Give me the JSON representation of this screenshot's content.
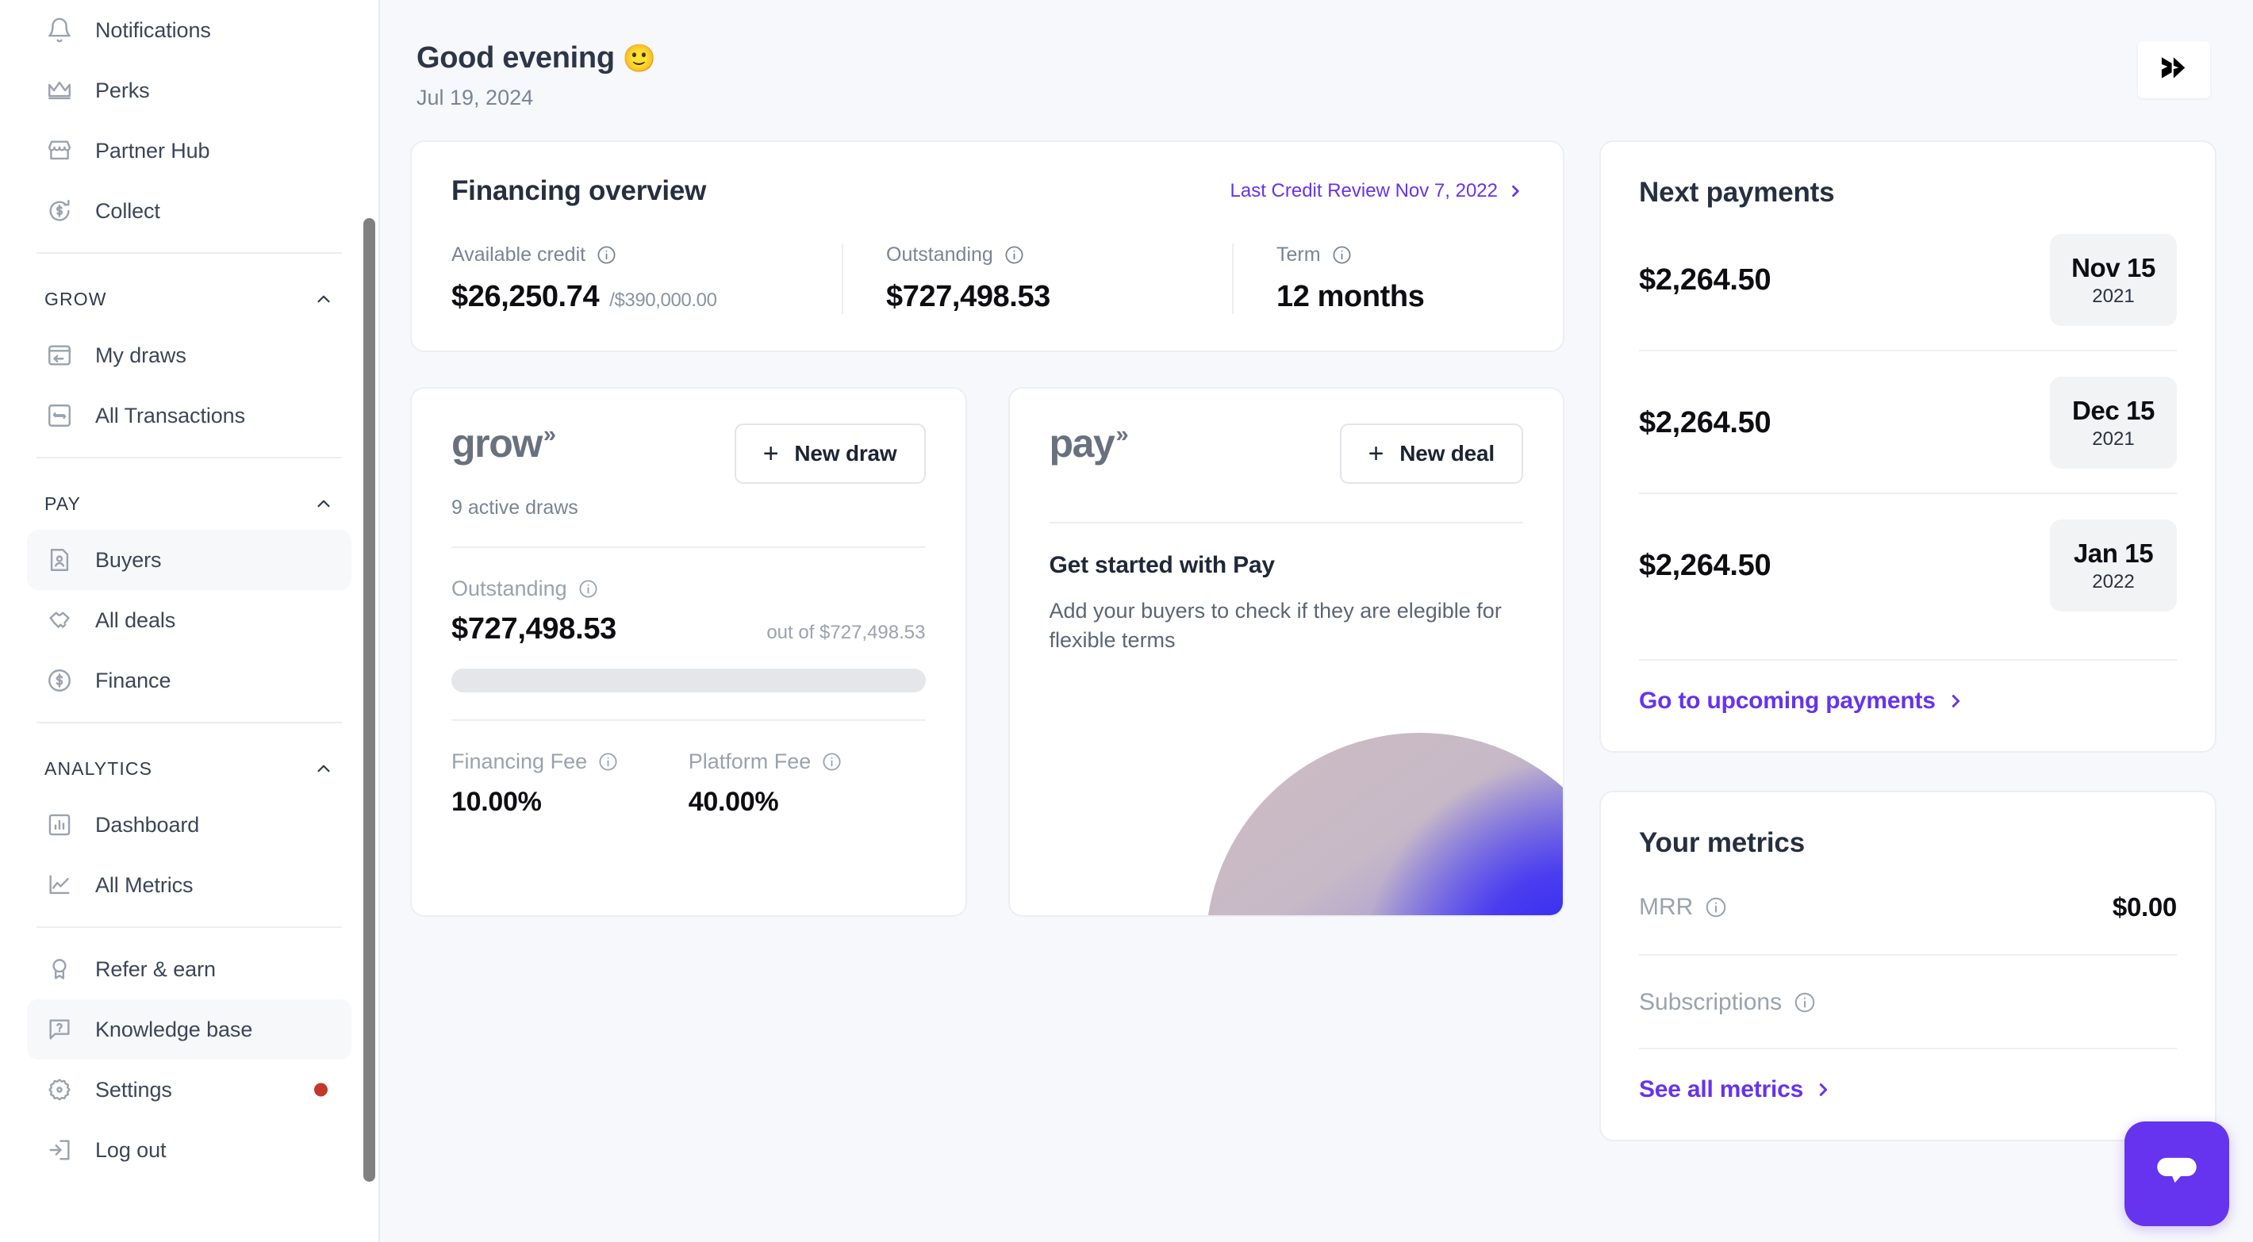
{
  "sidebar": {
    "top_items": [
      {
        "label": "Notifications",
        "icon": "bell-icon",
        "active": false
      },
      {
        "label": "Perks",
        "icon": "crown-icon",
        "active": false
      },
      {
        "label": "Partner Hub",
        "icon": "storefront-icon",
        "active": false
      },
      {
        "label": "Collect",
        "icon": "dollar-refresh-icon",
        "active": false
      }
    ],
    "sections": [
      {
        "title": "GROW",
        "expanded": true,
        "items": [
          {
            "label": "My draws",
            "icon": "draw-icon",
            "active": false
          },
          {
            "label": "All Transactions",
            "icon": "transactions-icon",
            "active": false
          }
        ]
      },
      {
        "title": "PAY",
        "expanded": true,
        "items": [
          {
            "label": "Buyers",
            "icon": "contact-card-icon",
            "active": true
          },
          {
            "label": "All deals",
            "icon": "handshake-icon",
            "active": false
          },
          {
            "label": "Finance",
            "icon": "dollar-circle-icon",
            "active": false
          }
        ]
      },
      {
        "title": "ANALYTICS",
        "expanded": true,
        "items": [
          {
            "label": "Dashboard",
            "icon": "bar-chart-icon",
            "active": false
          },
          {
            "label": "All Metrics",
            "icon": "line-chart-icon",
            "active": false
          }
        ]
      }
    ],
    "bottom_items": [
      {
        "label": "Refer & earn",
        "icon": "award-icon",
        "active": false,
        "badge": false
      },
      {
        "label": "Knowledge base",
        "icon": "help-chat-icon",
        "active": true,
        "badge": false
      },
      {
        "label": "Settings",
        "icon": "gear-icon",
        "active": false,
        "badge": true
      },
      {
        "label": "Log out",
        "icon": "logout-icon",
        "active": false,
        "badge": false
      }
    ]
  },
  "header": {
    "greeting": "Good evening",
    "emoji": "🙂",
    "date": "Jul 19, 2024",
    "brand_icon": "chevron-double-logo"
  },
  "financing_overview": {
    "title": "Financing overview",
    "link_label": "Last Credit Review Nov 7, 2022",
    "stats": [
      {
        "label": "Available credit",
        "value": "$26,250.74",
        "sub": "/$390,000.00",
        "info": true
      },
      {
        "label": "Outstanding",
        "value": "$727,498.53",
        "sub": "",
        "info": true
      },
      {
        "label": "Term",
        "value": "12 months",
        "sub": "",
        "info": true
      }
    ]
  },
  "grow_card": {
    "logo": "grow",
    "logo_chevrons": "»",
    "button_label": "New draw",
    "button_plus": "+",
    "subtitle": "9 active draws",
    "outstanding_label": "Outstanding",
    "outstanding_value": "$727,498.53",
    "outstanding_of": "out of $727,498.53",
    "progress_percent": 0,
    "fees": [
      {
        "label": "Financing Fee",
        "value": "10.00%"
      },
      {
        "label": "Platform Fee",
        "value": "40.00%"
      }
    ]
  },
  "pay_card": {
    "logo": "pay",
    "logo_chevrons": "»",
    "button_label": "New deal",
    "button_plus": "+",
    "heading": "Get started with Pay",
    "description": "Add your buyers to check if they are elegible for flexible terms"
  },
  "next_payments": {
    "title": "Next payments",
    "items": [
      {
        "amount": "$2,264.50",
        "day": "Nov 15",
        "year": "2021"
      },
      {
        "amount": "$2,264.50",
        "day": "Dec 15",
        "year": "2021"
      },
      {
        "amount": "$2,264.50",
        "day": "Jan 15",
        "year": "2022"
      }
    ],
    "link_label": "Go to upcoming payments"
  },
  "your_metrics": {
    "title": "Your metrics",
    "rows": [
      {
        "label": "MRR",
        "value": "$0.00"
      },
      {
        "label": "Subscriptions",
        "value": ""
      }
    ],
    "link_label": "See all metrics"
  },
  "chat": {
    "icon": "chat-bubble-icon"
  },
  "colors": {
    "accent_purple": "#6633ee",
    "badge_red": "#c0392b",
    "page_bg": "#f7f8fb",
    "card_border": "#eceef2",
    "muted_text": "#9aa2ae"
  }
}
